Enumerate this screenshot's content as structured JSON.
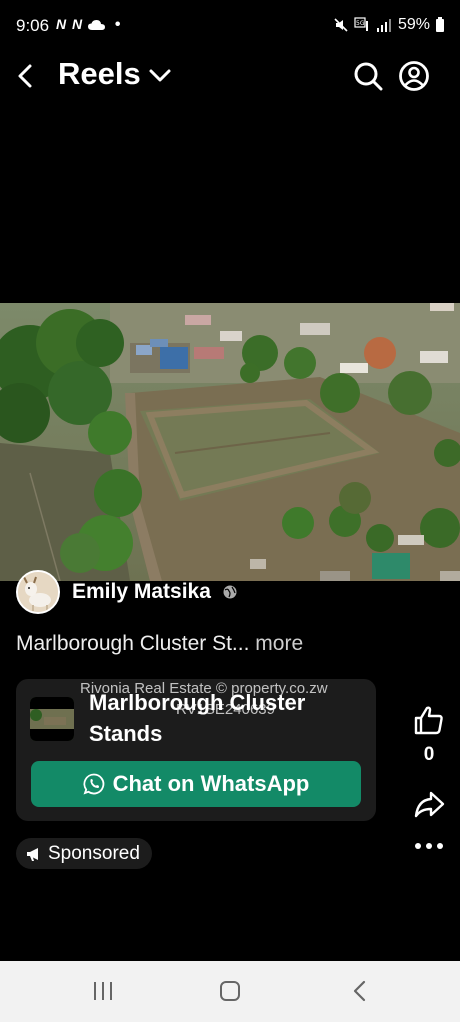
{
  "status_bar": {
    "time": "9:06",
    "notification_icons": "N N",
    "battery": "59%"
  },
  "header": {
    "title": "Reels"
  },
  "post": {
    "author": "Emily Matsika",
    "caption": "Marlborough Cluster St...",
    "more_label": "more"
  },
  "ad": {
    "watermark_line1": "Rivonia Real Estate © property.co.zw",
    "watermark_line2": "RV1SE240639",
    "title": "Marlborough Cluster Stands",
    "cta_label": "Chat on WhatsApp"
  },
  "actions": {
    "like_count": "0"
  },
  "sponsored_label": "Sponsored",
  "colors": {
    "whatsapp_button": "#138a67",
    "card_background": "#1c1c1c",
    "navbar_background": "#f2f2f2"
  }
}
